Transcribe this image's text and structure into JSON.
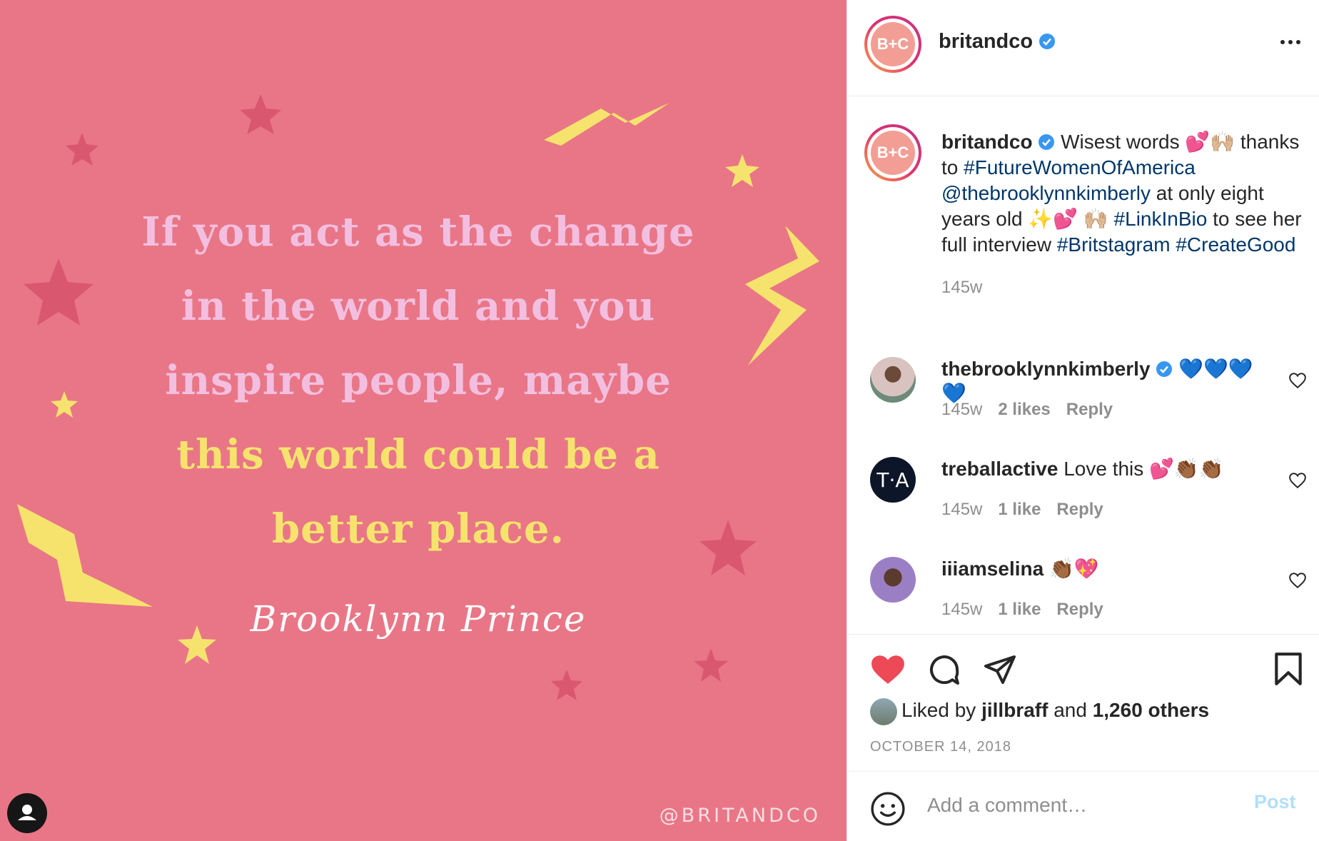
{
  "post_image": {
    "quote_lines_pink": [
      "If you act as the change",
      "in the world and you",
      "inspire people, maybe"
    ],
    "quote_lines_yellow": [
      "this world could be a",
      "better place."
    ],
    "author": "Brooklynn Prince",
    "watermark": "@BRITANDCO"
  },
  "header": {
    "avatar_text": "B+C",
    "username": "britandco"
  },
  "caption": {
    "username": "britandco",
    "parts": [
      {
        "text": "Wisest words 💕🙌🏼 thanks to ",
        "hl": false
      },
      {
        "text": "#FutureWomenOfAmerica",
        "hl": true
      },
      {
        "text": " ",
        "hl": false
      },
      {
        "text": "@thebrooklynnkimberly",
        "hl": true
      },
      {
        "text": " at only eight years old ✨💕 🙌🏼 ",
        "hl": false
      },
      {
        "text": "#LinkInBio",
        "hl": true
      },
      {
        "text": " to see her full interview ",
        "hl": false
      },
      {
        "text": "#Britstagram",
        "hl": true
      },
      {
        "text": " ",
        "hl": false
      },
      {
        "text": "#CreateGood",
        "hl": true
      }
    ],
    "time": "145w"
  },
  "comments": [
    {
      "username": "thebrooklynnkimberly",
      "verified": true,
      "text": "💙💙💙💙",
      "time": "145w",
      "likes": "2 likes",
      "reply": "Reply"
    },
    {
      "username": "treballactive",
      "verified": false,
      "avatar_text": "T·A",
      "text": "Love this 💕👏🏾👏🏾",
      "time": "145w",
      "likes": "1 like",
      "reply": "Reply"
    },
    {
      "username": "iiiamselina",
      "verified": false,
      "text": "👏🏾💖",
      "time": "145w",
      "likes": "1 like",
      "reply": "Reply"
    }
  ],
  "likes": {
    "prefix": "Liked by ",
    "user": "jillbraff",
    "middle": " and ",
    "count": "1,260 others"
  },
  "date": "OCTOBER 14, 2018",
  "comment_box": {
    "placeholder": "Add a comment…",
    "post_label": "Post"
  },
  "colors": {
    "image_bg": "#e97686",
    "like_red": "#ed4956",
    "link_blue": "#00376b",
    "verified_blue": "#3897f0"
  }
}
